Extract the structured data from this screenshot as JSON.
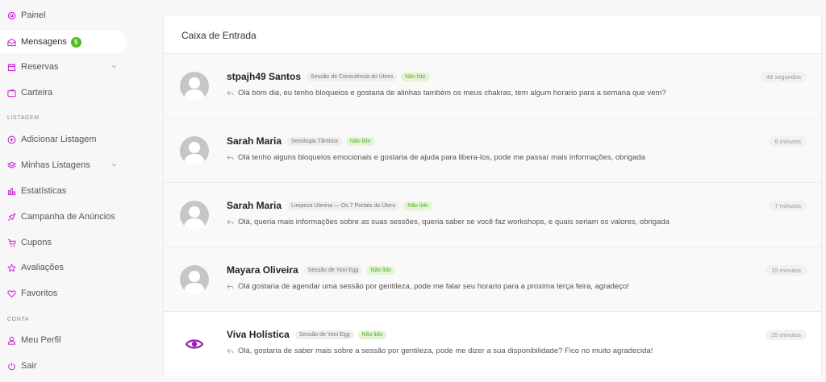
{
  "sidebar": {
    "items": [
      {
        "label": "Painel",
        "icon": "dashboard-icon"
      },
      {
        "label": "Mensagens",
        "icon": "envelope-icon",
        "badge": "5",
        "active": true
      },
      {
        "label": "Reservas",
        "icon": "calendar-icon",
        "has_submenu": true
      },
      {
        "label": "Carteira",
        "icon": "wallet-icon"
      }
    ],
    "section_listing": "LISTAGEM",
    "listing_items": [
      {
        "label": "Adicionar Listagem",
        "icon": "plus-circle-icon"
      },
      {
        "label": "Minhas Listagens",
        "icon": "layers-icon",
        "has_submenu": true
      },
      {
        "label": "Estatísticas",
        "icon": "bar-chart-icon"
      },
      {
        "label": "Campanha de Anúncios",
        "icon": "megaphone-icon"
      },
      {
        "label": "Cupons",
        "icon": "cart-icon"
      },
      {
        "label": "Avaliações",
        "icon": "star-icon"
      },
      {
        "label": "Favoritos",
        "icon": "heart-icon"
      }
    ],
    "section_account": "CONTA",
    "account_items": [
      {
        "label": "Meu Perfil",
        "icon": "user-icon"
      },
      {
        "label": "Sair",
        "icon": "power-icon"
      }
    ]
  },
  "inbox": {
    "title": "Caixa de Entrada",
    "messages": [
      {
        "name": "stpajh49 Santos",
        "service": "Sessão de Consciência do Útero",
        "status": "Não lido",
        "text": "Olá bom dia, eu tenho bloqueios e gostaria de alinhas também os meus chakras, tem algum horario para a semana que vem?",
        "time": "48 segundos",
        "avatar": "default-avatar"
      },
      {
        "name": "Sarah Maria",
        "service": "Sexologia Tântrica",
        "status": "Não lido",
        "text": "Olá tenho alguns bloqueios emocionais e gostaria de ajuda para libera-los, pode me passar mais informações, obrigada",
        "time": "6 minutos",
        "avatar": "default-avatar"
      },
      {
        "name": "Sarah Maria",
        "service": "Limpeza Uterina — Os 7 Portais do Útero",
        "status": "Não lido",
        "text": "Olá, queria mais informações sobre as suas sessões, queria saber se você faz workshops, e quais seriam os valores, obrigada",
        "time": "7 minutos",
        "avatar": "default-avatar"
      },
      {
        "name": "Mayara Oliveira",
        "service": "Sessão de Yoni Egg",
        "status": "Não lido",
        "text": "Olá gostaria de agendar uma sessão por gentileza, pode me falar seu horario para a proxima terça feira, agradeço!",
        "time": "15 minutos",
        "avatar": "default-avatar"
      },
      {
        "name": "Viva Holística",
        "service": "Sessão de Yoni Egg",
        "status": "Não lido",
        "text": "Olá, gostaria de saber mais sobre a sessão por gentileza, pode me dizer a sua disponibilidade? Fico no muito agradecida!",
        "time": "25 minutos",
        "avatar": "eye-logo"
      }
    ]
  },
  "colors": {
    "accent": "#c81fd6",
    "badge_green": "#54ba1d",
    "unread_bg": "#e2f6d6",
    "unread_text": "#5fa829"
  }
}
